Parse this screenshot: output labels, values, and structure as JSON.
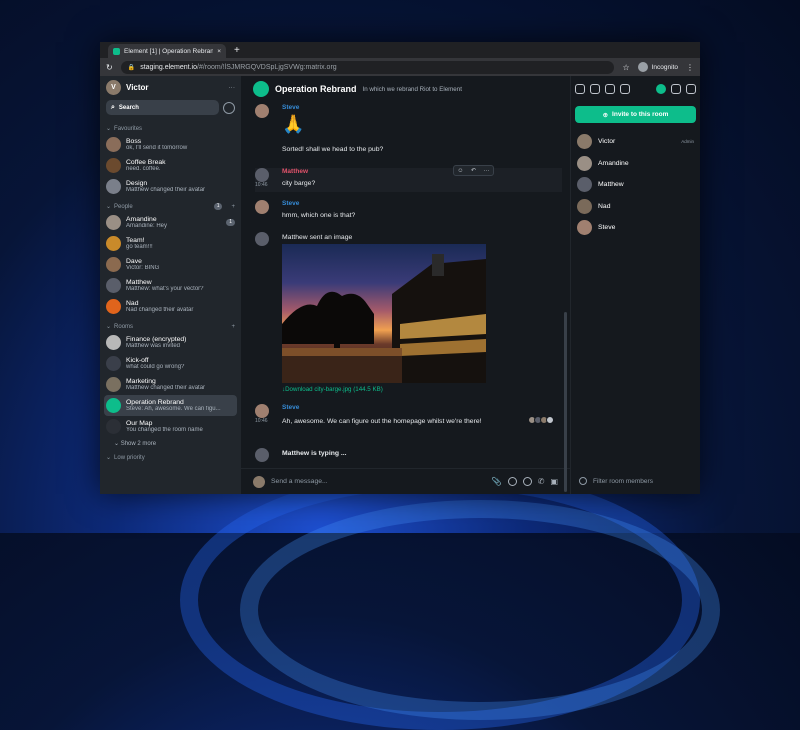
{
  "browser": {
    "tab_title": "Element [1] | Operation Rebrand",
    "tab_close": "×",
    "new_tab": "+",
    "url_host": "staging.element.io",
    "url_path": "/#/room/!lSJMRGQVDSpLjgSVWg:matrix.org",
    "incognito_label": "Incognito"
  },
  "sidebar": {
    "user_name": "Victor",
    "search_label": "Search",
    "sections": {
      "favourites": "Favourites",
      "people": "People",
      "people_badge": "1",
      "rooms": "Rooms",
      "low_priority": "Low priority"
    },
    "favourites": [
      {
        "name": "Boss",
        "preview": "ok, I'll send it tomorrow",
        "color": "#8a6d5a"
      },
      {
        "name": "Coffee Break",
        "preview": "need. coffee.",
        "color": "#6b4a2e"
      },
      {
        "name": "Design",
        "preview": "Matthew changed their avatar",
        "color": "#7a7f8a"
      }
    ],
    "people": [
      {
        "name": "Amandine",
        "preview": "Amandine: Hey",
        "color": "#9a8f85",
        "badge": "1"
      },
      {
        "name": "Team!",
        "preview": "go team!!!",
        "color": "#c98a2a",
        "badge": ""
      },
      {
        "name": "Dave",
        "preview": "Victor: BING",
        "color": "#8b6a4f",
        "badge": ""
      },
      {
        "name": "Matthew",
        "preview": "Matthew: what's your vector?",
        "color": "#5a5e6a",
        "badge": ""
      },
      {
        "name": "Nad",
        "preview": "Nad changed their avatar",
        "color": "#e0641c",
        "badge": ""
      }
    ],
    "rooms": [
      {
        "name": "Finance (encrypted)",
        "preview": "Matthew was invited",
        "color": "#b8b8b8",
        "active": false
      },
      {
        "name": "Kick-off",
        "preview": "what could go wrong?",
        "color": "#3a3f4a",
        "active": false
      },
      {
        "name": "Marketing",
        "preview": "Matthew changed their avatar",
        "color": "#7a7060",
        "active": false
      },
      {
        "name": "Operation Rebrand",
        "preview": "Steve: Ah, awesome. We can figu...",
        "color": "#0dbd8b",
        "active": true
      },
      {
        "name": "Our Map",
        "preview": "You changed the room name",
        "color": "#2b2f36",
        "active": false
      }
    ],
    "show_more": "Show 2 more"
  },
  "room": {
    "name": "Operation Rebrand",
    "topic": "In which we rebrand Riot to Element",
    "composer_placeholder": "Send a message..."
  },
  "timeline": {
    "m1": {
      "sender": "Steve",
      "emoji": "🙏",
      "text": "Sorted! shall we head to the pub?"
    },
    "m2": {
      "sender": "Matthew",
      "time": "10:46",
      "text": "city barge?"
    },
    "m3": {
      "sender": "Steve",
      "text": "hmm, which one is that?"
    },
    "m4": {
      "text": "Matthew sent an image",
      "download": "Download city-barge.jpg (144.5 KB)"
    },
    "m5": {
      "sender": "Steve",
      "time": "10:46",
      "text": "Ah, awesome. We can figure out the homepage whilst we're there!"
    },
    "typing": "Matthew is typing ..."
  },
  "right_panel": {
    "invite_label": "Invite to this room",
    "filter_placeholder": "Filter room members",
    "members": [
      {
        "name": "Victor",
        "power": "Admin",
        "color": "#8a7a6a"
      },
      {
        "name": "Amandine",
        "power": "",
        "color": "#9a8f85"
      },
      {
        "name": "Matthew",
        "power": "",
        "color": "#5a5e6a"
      },
      {
        "name": "Nad",
        "power": "",
        "color": "#7a6a5a"
      },
      {
        "name": "Steve",
        "power": "",
        "color": "#a08070"
      }
    ]
  },
  "colors": {
    "accent": "#0dbd8b",
    "steve": "#368bd6",
    "matthew": "#e0526a"
  }
}
